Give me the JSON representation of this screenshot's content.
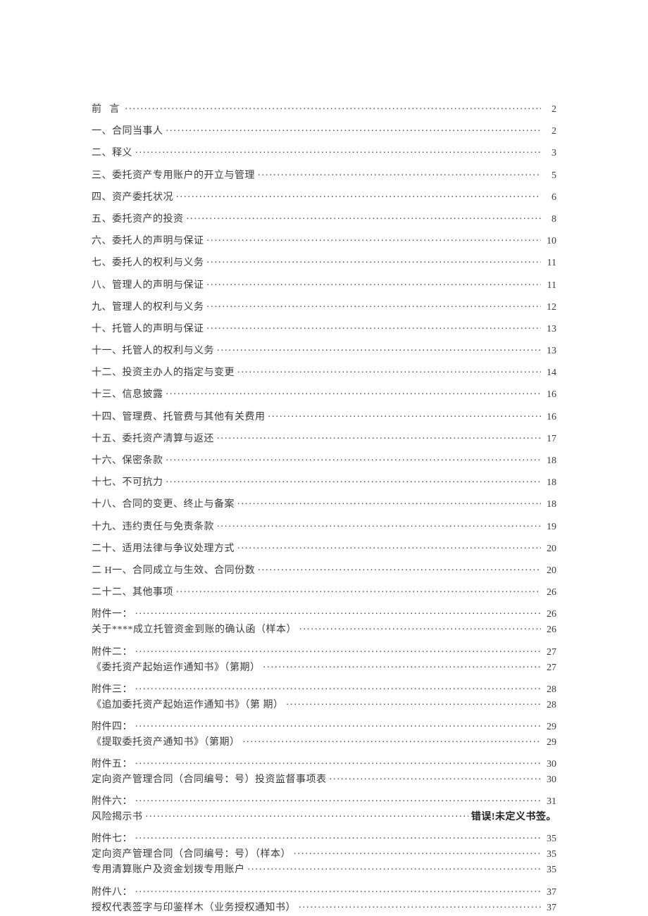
{
  "toc": [
    {
      "label": "前 言",
      "page": "2",
      "spaced": true
    },
    {
      "label": "一、合同当事人",
      "page": "2"
    },
    {
      "label": "二、释义",
      "page": "3"
    },
    {
      "label": "三、委托资产专用账户的开立与管理",
      "page": "5"
    },
    {
      "label": "四、资产委托状况",
      "page": "6"
    },
    {
      "label": "五、委托资产的投资",
      "page": "8"
    },
    {
      "label": "六、委托人的声明与保证",
      "page": "10"
    },
    {
      "label": "七、委托人的权利与义务",
      "page": "11"
    },
    {
      "label": "八、管理人的声明与保证",
      "page": "11"
    },
    {
      "label": "九、管理人的权利与义务",
      "page": "12"
    },
    {
      "label": "十、托管人的声明与保证",
      "page": "13"
    },
    {
      "label": "十一、托管人的权利与义务",
      "page": "13"
    },
    {
      "label": "十二、投资主办人的指定与变更",
      "page": "14"
    },
    {
      "label": "十三、信息披露",
      "page": "16"
    },
    {
      "label": "十四、管理费、托管费与其他有关费用",
      "page": "16"
    },
    {
      "label": "十五、委托资产清算与返还",
      "page": "17"
    },
    {
      "label": "十六、保密条款",
      "page": "18"
    },
    {
      "label": "十七、不可抗力",
      "page": "18"
    },
    {
      "label": "十八、合同的变更、终止与备案",
      "page": "18"
    },
    {
      "label": "十九、违约责任与免责条款",
      "page": "19"
    },
    {
      "label": "二十、适用法律与争议处理方式",
      "page": "20"
    },
    {
      "label": "二 H一、合同成立与生效、合同份数",
      "page": "20"
    },
    {
      "label": "二十二、其他事项",
      "page": "26"
    },
    {
      "label": "附件一：",
      "page": "26",
      "tight": true
    },
    {
      "label": "关于****成立托管资金到账的确认函（样本）",
      "page": "26"
    },
    {
      "label": "附件二：",
      "page": "27",
      "tight": true
    },
    {
      "label": "《委托资产起始运作通知书》（第期）",
      "page": "27"
    },
    {
      "label": "附件三：",
      "page": "28",
      "tight": true
    },
    {
      "label": "《追加委托资产起始运作通知书》（第 期）",
      "page": "28"
    },
    {
      "label": "附件四：",
      "page": "29",
      "tight": true
    },
    {
      "label": "《提取委托资产通知书》（第期）",
      "page": "29"
    },
    {
      "label": "附件五：",
      "page": "30",
      "tight": true
    },
    {
      "label": "定向资产管理合同（合同编号：号）投资监督事项表",
      "page": "30"
    },
    {
      "label": "附件六：",
      "page": "31",
      "tight": true
    },
    {
      "label": "风险揭示书",
      "page": "错误!未定义书签。",
      "error": true
    },
    {
      "label": "附件七：",
      "page": "35",
      "tight": true
    },
    {
      "label": "定向资产管理合同（合同编号：号）（样本）",
      "page": "35",
      "tight": true
    },
    {
      "label": "专用清算账户及资金划拨专用账户",
      "page": "35"
    },
    {
      "label": "附件八：",
      "page": "37",
      "tight": true
    },
    {
      "label": "授权代表签字与印鉴样木（业务授权通知书）",
      "page": "37"
    }
  ]
}
